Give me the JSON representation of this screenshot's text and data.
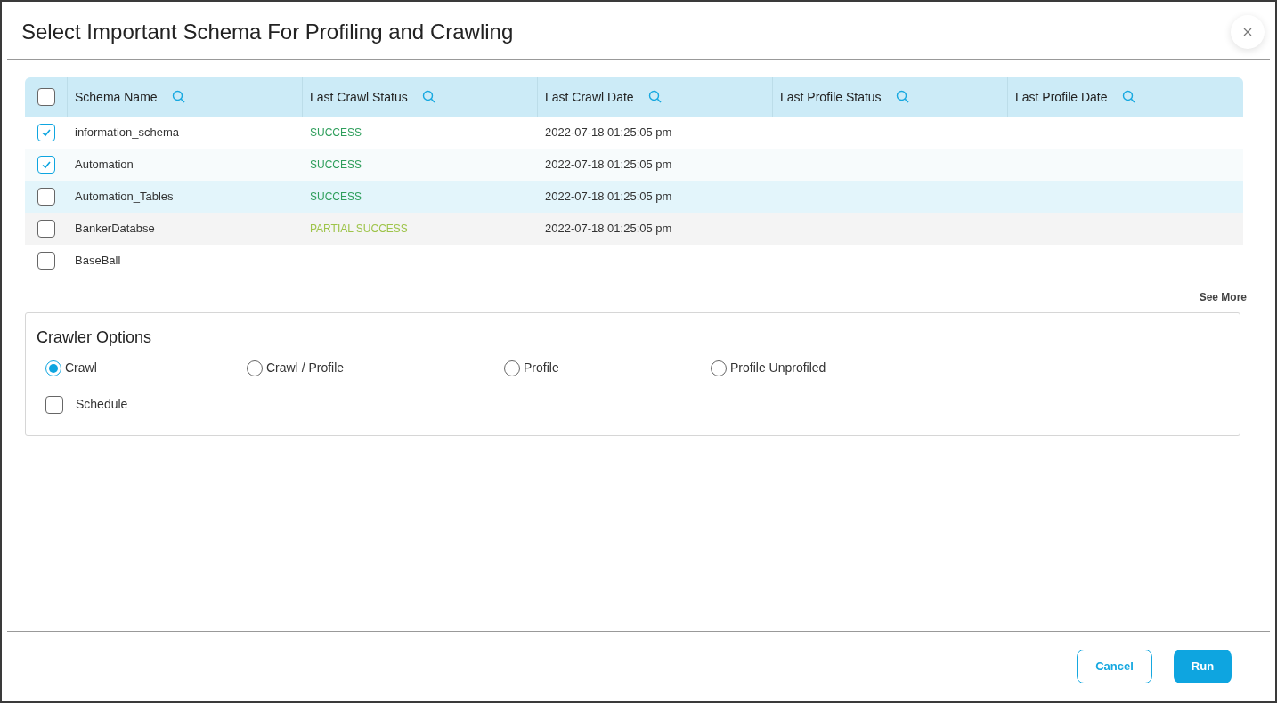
{
  "dialog": {
    "title": "Select Important Schema For Profiling and Crawling"
  },
  "table": {
    "select_all": {
      "checked": false
    },
    "columns": [
      "Schema Name",
      "Last Crawl Status",
      "Last Crawl Date",
      "Last Profile Status",
      "Last Profile Date"
    ],
    "rows": [
      {
        "checked": true,
        "highlighted": false,
        "name": "information_schema",
        "crawl_status": {
          "text": "SUCCESS",
          "color": "#2e9e5b"
        },
        "crawl_date": "2022-07-18 01:25:05 pm"
      },
      {
        "checked": true,
        "highlighted": false,
        "name": "Automation",
        "crawl_status": {
          "text": "SUCCESS",
          "color": "#2e9e5b"
        },
        "crawl_date": "2022-07-18 01:25:05 pm"
      },
      {
        "checked": false,
        "highlighted": true,
        "name": "Automation_Tables",
        "crawl_status": {
          "text": "SUCCESS",
          "color": "#2e9e5b"
        },
        "crawl_date": "2022-07-18 01:25:05 pm"
      },
      {
        "checked": false,
        "highlighted": false,
        "name": "BankerDatabse",
        "crawl_status": {
          "text": "PARTIAL SUCCESS",
          "color": "#9ec44a"
        },
        "crawl_date": "2022-07-18 01:25:05 pm"
      },
      {
        "checked": false,
        "highlighted": false,
        "name": "BaseBall"
      }
    ]
  },
  "see_more": "See More",
  "crawler_options": {
    "title": "Crawler Options",
    "modes": [
      {
        "label": "Crawl",
        "selected": true
      },
      {
        "label": "Crawl / Profile",
        "selected": false
      },
      {
        "label": "Profile",
        "selected": false
      },
      {
        "label": "Profile Unprofiled",
        "selected": false
      }
    ],
    "schedule": {
      "label": "Schedule",
      "checked": false
    }
  },
  "buttons": {
    "cancel": "Cancel",
    "run": "Run"
  }
}
